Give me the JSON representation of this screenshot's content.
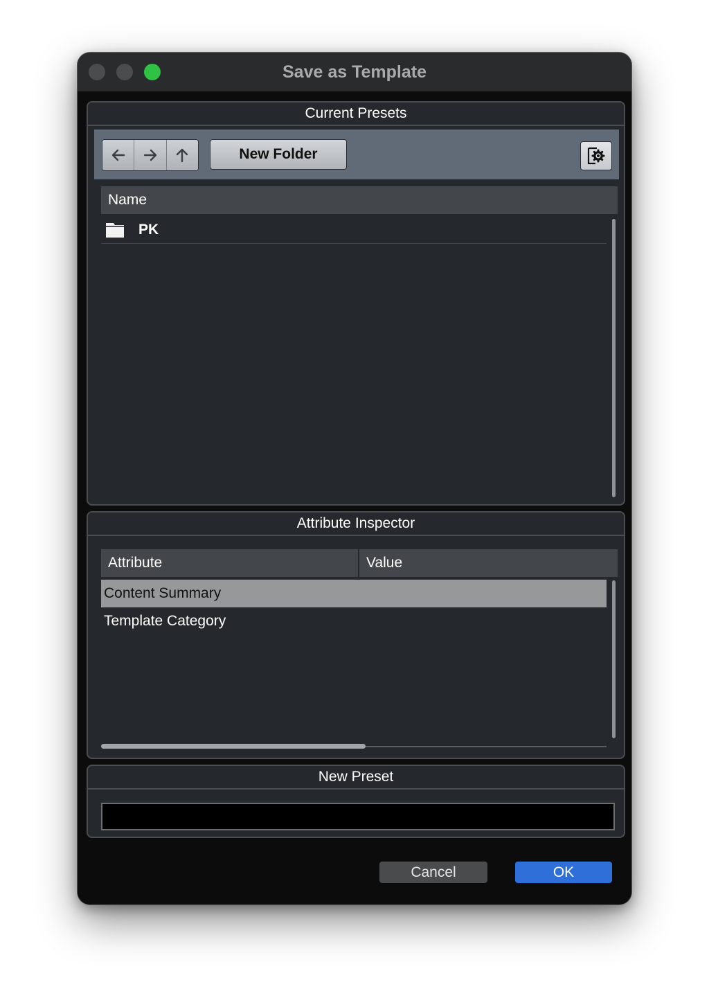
{
  "window": {
    "title": "Save as Template"
  },
  "presets_panel": {
    "title": "Current Presets",
    "new_folder_label": "New Folder",
    "column_name": "Name",
    "items": [
      {
        "name": "PK",
        "icon": "folder-icon"
      }
    ]
  },
  "inspector_panel": {
    "title": "Attribute Inspector",
    "col_attribute": "Attribute",
    "col_value": "Value",
    "rows": [
      {
        "attribute": "Content Summary",
        "value": ""
      },
      {
        "attribute": "Template Category",
        "value": ""
      }
    ]
  },
  "new_preset_panel": {
    "title": "New Preset",
    "value": ""
  },
  "buttons": {
    "cancel": "Cancel",
    "ok": "OK"
  },
  "colors": {
    "accent": "#2f6fd9",
    "zoom_button": "#2fc245"
  }
}
